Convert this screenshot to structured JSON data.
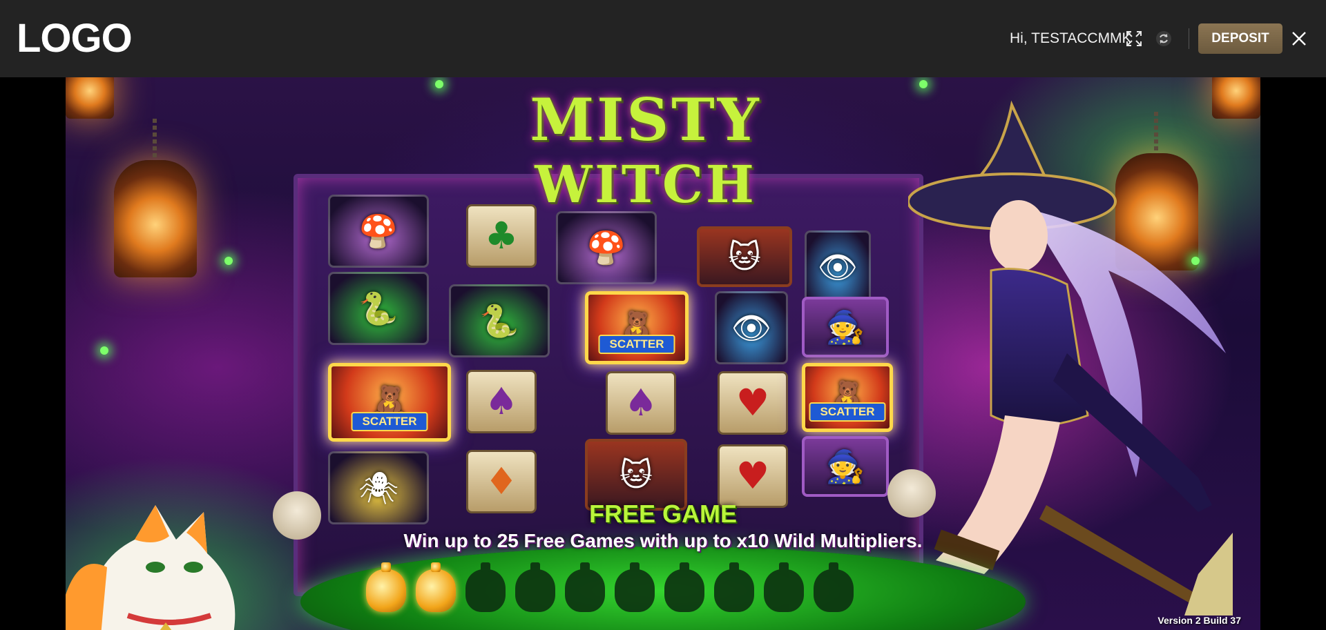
{
  "header": {
    "logo_text": "LOGO",
    "greeting": "Hi, TESTACCMMK",
    "deposit_label": "DEPOSIT",
    "icons": [
      "fullscreen-icon",
      "refresh-icon",
      "close-icon"
    ]
  },
  "game": {
    "title_line1": "MISTY",
    "title_line2": "WITCH",
    "scatter_label": "SCATTER",
    "free_game_title": "FREE GAME",
    "free_game_description": "Win up to 25 Free Games with up to x10 Wild Multipliers.",
    "version": "Version 2 Build 37",
    "potions": {
      "filled": 2,
      "total": 10
    },
    "reels": [
      [
        "mushroom-jar",
        "snake-jar",
        "scatter",
        "spider-jar"
      ],
      [
        "club-card",
        "snake-jar",
        "spade-card",
        "diamond-card"
      ],
      [
        "mushroom-jar",
        "scatter",
        "spade-card",
        "cat-portrait"
      ],
      [
        "cat-portrait",
        "eyeball-jar",
        "heart-card",
        "heart-card"
      ],
      [
        "eyeball-jar",
        "witch-portrait",
        "scatter",
        "witch-portrait"
      ]
    ]
  },
  "colors": {
    "topbar": "#232323",
    "deposit_button": "#7c6748",
    "title_green": "#c6f23c",
    "free_game_green": "#b9f53a"
  }
}
